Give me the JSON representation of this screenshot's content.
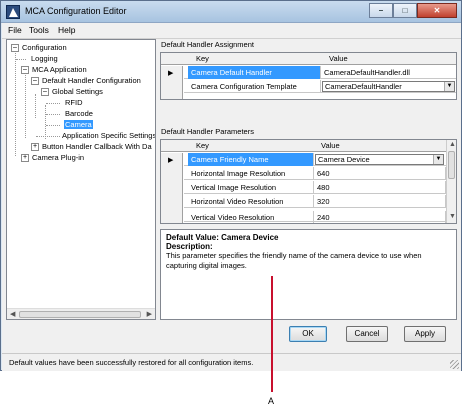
{
  "window": {
    "title": "MCA Configuration Editor"
  },
  "menu": [
    "File",
    "Tools",
    "Help"
  ],
  "tree": {
    "items": [
      "Configuration",
      "Logging",
      "MCA Application",
      "Default Handler Configuration",
      "Global Settings",
      "RFID",
      "Barcode",
      "Camera",
      "Application Specific Settings",
      "Button Handler Callback With Da",
      "Camera Plug-in"
    ]
  },
  "assignment": {
    "title": "Default Handler Assignment",
    "columns": [
      "Key",
      "Value"
    ],
    "rows": [
      {
        "key": "Camera Default Handler",
        "value": "CameraDefaultHandler.dll"
      },
      {
        "key": "Camera Configuration Template",
        "value": "CameraDefaultHandler"
      }
    ]
  },
  "parameters": {
    "title": "Default Handler Parameters",
    "columns": [
      "Key",
      "Value"
    ],
    "rows": [
      {
        "key": "Camera Friendly Name",
        "value": "Camera Device"
      },
      {
        "key": "Horizontal Image Resolution",
        "value": "640"
      },
      {
        "key": "Vertical Image Resolution",
        "value": "480"
      },
      {
        "key": "Horizontal Video Resolution",
        "value": "320"
      },
      {
        "key": "Vertical Video Resolution",
        "value": "240"
      }
    ]
  },
  "description": {
    "default_value": "Default Value: Camera Device",
    "heading": "Description:",
    "text": "This parameter specifies the friendly name of the camera device to use when capturing digital images."
  },
  "buttons": {
    "ok": "OK",
    "cancel": "Cancel",
    "apply": "Apply"
  },
  "status": "Default values have been successfully restored for all configuration items.",
  "callout": "A",
  "colors": {
    "selection": "#3399ff",
    "callout": "#c8102e"
  },
  "icons": {
    "window": "app-icon",
    "minimize": "minimize-icon",
    "maximize": "maximize-icon",
    "close": "close-icon"
  }
}
